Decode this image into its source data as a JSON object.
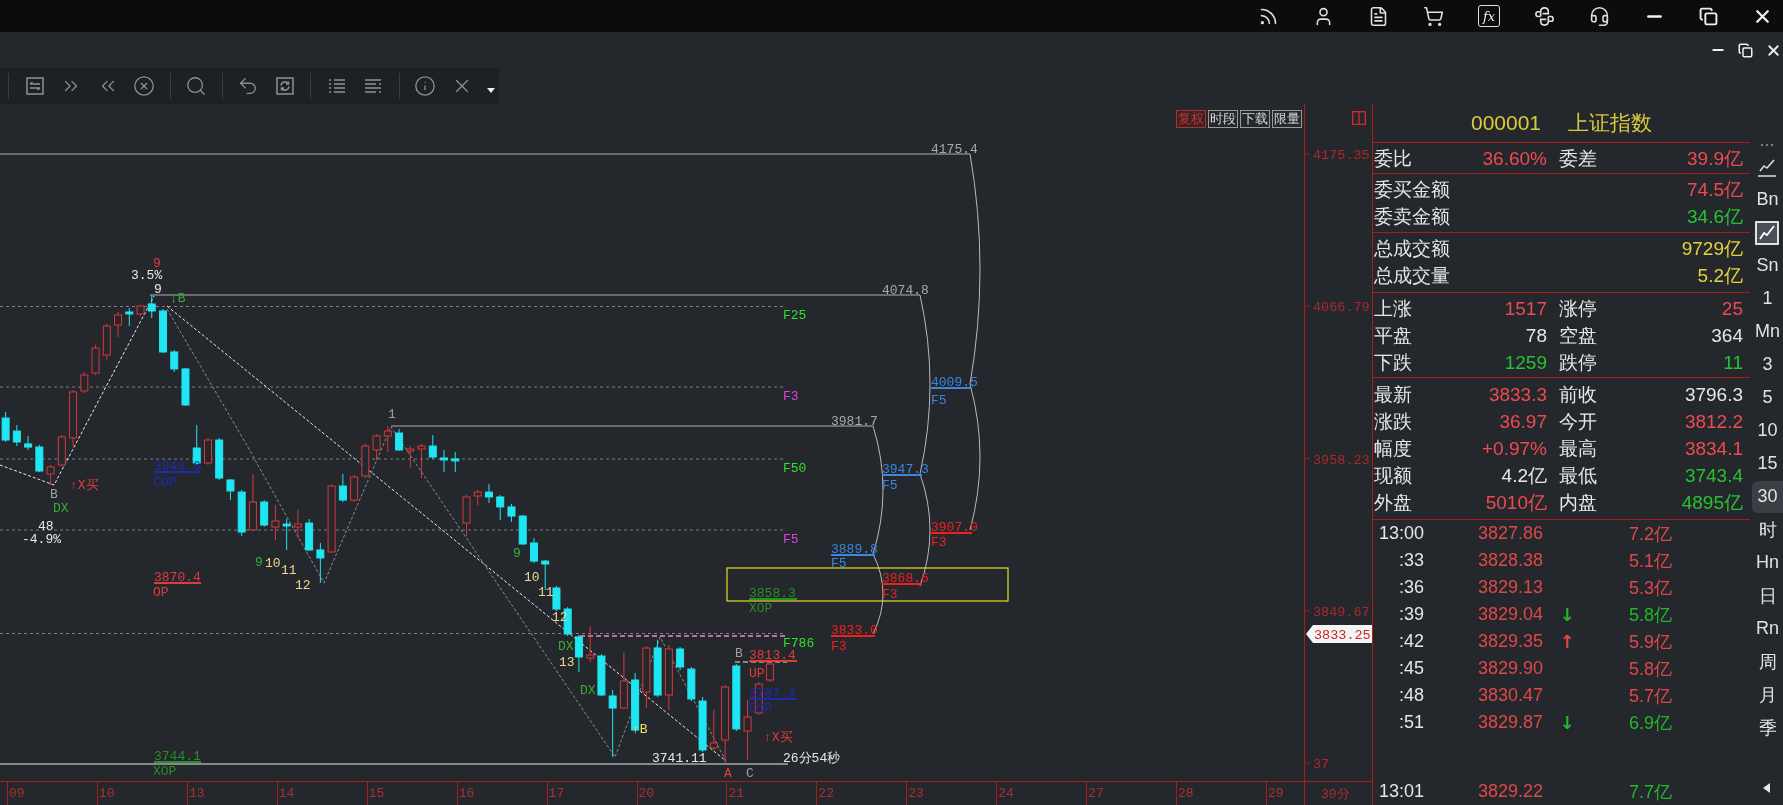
{
  "title_bar": {
    "formula_label": "fx"
  },
  "chart": {
    "buttons": [
      {
        "label": "复权",
        "on": true
      },
      {
        "label": "时段",
        "on": false
      },
      {
        "label": "下载",
        "on": false
      },
      {
        "label": "限量",
        "on": false
      }
    ],
    "chart_data": {
      "type": "candlestick",
      "categories": [
        null,
        "09",
        null,
        null,
        null,
        null,
        null,
        null,
        null,
        "10",
        null,
        null,
        null,
        null,
        null,
        null,
        null,
        "13",
        null,
        null,
        null,
        null,
        null,
        null,
        null,
        "14",
        null,
        null,
        null,
        null,
        null,
        null,
        null,
        "15",
        null,
        null,
        null,
        null,
        null,
        null,
        null,
        "16",
        null,
        null,
        null,
        null,
        null,
        null,
        null,
        "17",
        null,
        null,
        null,
        null,
        null,
        null,
        null,
        "20",
        null,
        null,
        null,
        null,
        null,
        null,
        null,
        "21",
        null,
        null,
        null,
        null,
        null,
        null,
        null,
        "22",
        null,
        null,
        null,
        null,
        null,
        null,
        null,
        "23",
        null,
        null,
        null,
        null,
        null,
        null,
        null,
        "24",
        null,
        null,
        null,
        null,
        null,
        null,
        null,
        "27",
        null,
        null,
        null,
        null,
        null,
        null,
        null,
        "28",
        null,
        null,
        null,
        null,
        null,
        null,
        null,
        "29",
        null,
        null
      ],
      "ohlc": [
        [
          3987.1,
          3991.4,
          3970.0,
          3971.4
        ],
        [
          3977.8,
          3982.1,
          3967.1,
          3970.0
        ],
        [
          3968.6,
          3974.3,
          3964.3,
          3966.4
        ],
        [
          3966.4,
          3967.9,
          3948.6,
          3949.3
        ],
        [
          3947.2,
          3953.6,
          3939.3,
          3952.2
        ],
        [
          3953.6,
          3975.0,
          3952.2,
          3973.6
        ],
        [
          3972.9,
          4007.1,
          3967.1,
          4005.7
        ],
        [
          4006.4,
          4019.9,
          4004.9,
          4017.8
        ],
        [
          4019.2,
          4039.2,
          4017.8,
          4037.0
        ],
        [
          4032.0,
          4054.1,
          4028.5,
          4052.7
        ],
        [
          4053.4,
          4062.7,
          4044.9,
          4060.6
        ],
        [
          4062.7,
          4065.5,
          4052.7,
          4061.3
        ],
        [
          4061.3,
          4067.7,
          4059.8,
          4067.0
        ],
        [
          4068.4,
          4074.8,
          4058.4,
          4063.4
        ],
        [
          4063.4,
          4064.8,
          4033.5,
          4034.2
        ],
        [
          4034.2,
          4035.6,
          4019.9,
          4022.1
        ],
        [
          4022.1,
          4022.8,
          3995.7,
          3996.4
        ],
        [
          3965.7,
          3982.1,
          3953.6,
          3955.0
        ],
        [
          3955.0,
          3972.9,
          3953.6,
          3971.4
        ],
        [
          3971.4,
          3972.9,
          3942.9,
          3944.3
        ],
        [
          3942.9,
          3943.6,
          3928.6,
          3935.1
        ],
        [
          3934.3,
          3935.8,
          3903.0,
          3905.8
        ],
        [
          3907.3,
          3947.2,
          3906.5,
          3927.2
        ],
        [
          3927.2,
          3928.6,
          3909.4,
          3910.8
        ],
        [
          3909.4,
          3925.1,
          3900.1,
          3913.7
        ],
        [
          3911.5,
          3915.1,
          3893.0,
          3910.1
        ],
        [
          3909.4,
          3921.5,
          3901.5,
          3911.5
        ],
        [
          3912.2,
          3915.1,
          3892.3,
          3893.0
        ],
        [
          3893.0,
          3898.0,
          3869.5,
          3887.3
        ],
        [
          3891.6,
          3940.1,
          3890.9,
          3938.6
        ],
        [
          3938.6,
          3947.2,
          3927.2,
          3928.6
        ],
        [
          3928.6,
          3946.5,
          3927.2,
          3945.0
        ],
        [
          3945.8,
          3968.6,
          3944.3,
          3967.1
        ],
        [
          3964.3,
          3975.7,
          3957.2,
          3974.3
        ],
        [
          3974.3,
          3981.4,
          3962.9,
          3977.8
        ],
        [
          3976.4,
          3979.3,
          3963.6,
          3964.3
        ],
        [
          3963.6,
          3967.1,
          3951.5,
          3965.0
        ],
        [
          3965.0,
          3968.6,
          3944.3,
          3967.1
        ],
        [
          3967.1,
          3975.0,
          3957.9,
          3959.3
        ],
        [
          3958.6,
          3964.3,
          3948.6,
          3957.2
        ],
        [
          3957.9,
          3962.9,
          3948.6,
          3956.5
        ],
        [
          3912.2,
          3932.2,
          3903.0,
          3930.8
        ],
        [
          3931.5,
          3935.8,
          3925.1,
          3934.3
        ],
        [
          3934.3,
          3940.1,
          3926.5,
          3930.8
        ],
        [
          3930.8,
          3932.2,
          3914.4,
          3923.7
        ],
        [
          3923.7,
          3925.8,
          3913.0,
          3917.2
        ],
        [
          3917.2,
          3917.9,
          3896.6,
          3897.3
        ],
        [
          3898.0,
          3901.5,
          3883.7,
          3885.1
        ],
        [
          3885.1,
          3885.9,
          3864.5,
          3883.0
        ],
        [
          3865.9,
          3867.3,
          3849.5,
          3850.9
        ],
        [
          3850.9,
          3852.3,
          3831.7,
          3833.1
        ],
        [
          3831.0,
          3832.4,
          3806.0,
          3816.7
        ],
        [
          3816.0,
          3838.8,
          3813.1,
          3818.1
        ],
        [
          3817.4,
          3818.8,
          3788.9,
          3789.6
        ],
        [
          3788.9,
          3793.2,
          3745.4,
          3780.3
        ],
        [
          3780.3,
          3820.3,
          3779.6,
          3799.6
        ],
        [
          3800.3,
          3805.3,
          3763.9,
          3764.6
        ],
        [
          3791.7,
          3824.5,
          3780.3,
          3823.1
        ],
        [
          3823.1,
          3828.8,
          3788.2,
          3789.6
        ],
        [
          3789.6,
          3825.3,
          3778.9,
          3822.4
        ],
        [
          3822.4,
          3823.8,
          3807.4,
          3809.6
        ],
        [
          3808.1,
          3809.6,
          3785.3,
          3786.8
        ],
        [
          3785.3,
          3788.2,
          3749.0,
          3750.4
        ],
        [
          3751.8,
          3778.9,
          3750.4,
          3755.4
        ],
        [
          3757.5,
          3796.7,
          3741.1,
          3795.3
        ],
        [
          3810.3,
          3811.7,
          3763.9,
          3765.4
        ],
        [
          3763.9,
          3786.0,
          3743.4,
          3773.9
        ],
        [
          3776.8,
          3798.9,
          3775.3,
          3797.4
        ],
        [
          3800.3,
          3813.1,
          3798.9,
          3811.7
        ],
        null,
        null,
        null,
        null,
        null,
        null,
        null,
        null,
        null,
        null,
        null,
        null,
        null,
        null,
        null,
        null,
        null,
        null,
        null,
        null,
        null,
        null,
        null,
        null,
        null,
        null,
        null,
        null,
        null,
        null,
        null,
        null,
        null,
        null,
        null,
        null,
        null,
        null,
        null,
        null,
        null,
        null,
        null,
        null,
        null,
        null,
        null
      ],
      "ylim": [
        3728.28,
        4192.46
      ],
      "yticks": [
        {
          "value": 4175.35,
          "label": "4175.35"
        },
        {
          "value": 4066.79,
          "label": "4066.79"
        },
        {
          "value": 3958.23,
          "label": "3958.23"
        },
        {
          "value": 3849.67,
          "label": "3849.67"
        }
      ]
    },
    "y_axis_bottom_label": "37",
    "annotations": [
      {
        "text": "4175.4",
        "color": "#a8a8a8",
        "kind": "label"
      },
      {
        "text": "9",
        "color": "#e03c3c",
        "kind": "label"
      },
      {
        "text": "3.5%",
        "color": "#e8e8e8",
        "kind": "label"
      },
      {
        "text": "9",
        "color": "#e8e8e8",
        "kind": "label"
      },
      {
        "text": "4074.8",
        "color": "#a8a8a8",
        "kind": "label"
      },
      {
        "text": "↓B",
        "color": "#34b034",
        "kind": "label"
      },
      {
        "text": "F25",
        "color": "#30e030",
        "kind": "label"
      },
      {
        "text": "4009.5",
        "color": "#3a86e0",
        "kind": "level"
      },
      {
        "text": "F3",
        "color": "#e040e0",
        "kind": "label"
      },
      {
        "text": "F5",
        "color": "#3a86e0",
        "kind": "label"
      },
      {
        "text": "1",
        "color": "#a0a0a0",
        "kind": "label"
      },
      {
        "text": "3981.7",
        "color": "#a8a8a8",
        "kind": "label"
      },
      {
        "text": "3948.6",
        "color": "#1c2bb0",
        "kind": "level"
      },
      {
        "text": "F50",
        "color": "#30e030",
        "kind": "label"
      },
      {
        "text": "3947.3",
        "color": "#3a86e0",
        "kind": "level"
      },
      {
        "text": "↑X买",
        "color": "#e03c3c",
        "kind": "label"
      },
      {
        "text": "COP",
        "color": "#1c2bb0",
        "kind": "label"
      },
      {
        "text": "F5",
        "color": "#3a86e0",
        "kind": "label"
      },
      {
        "text": "B",
        "color": "#a0a0a0",
        "kind": "label"
      },
      {
        "text": "DX",
        "color": "#34b034",
        "kind": "label"
      },
      {
        "text": "48",
        "color": "#e8e8e8",
        "kind": "label"
      },
      {
        "text": "3907.0",
        "color": "#ee2020",
        "kind": "level"
      },
      {
        "text": "-4.9%",
        "color": "#e8e8e8",
        "kind": "label"
      },
      {
        "text": "F5",
        "color": "#e040e0",
        "kind": "label"
      },
      {
        "text": "F3",
        "color": "#ee2020",
        "kind": "label"
      },
      {
        "text": "9",
        "color": "#34b034",
        "kind": "label"
      },
      {
        "text": "3889.8",
        "color": "#3a86e0",
        "kind": "level"
      },
      {
        "text": "9",
        "color": "#34b034",
        "kind": "label"
      },
      {
        "text": "10",
        "color": "#f0d890",
        "kind": "label"
      },
      {
        "text": "F5",
        "color": "#3a86e0",
        "kind": "label"
      },
      {
        "text": "11",
        "color": "#f0d890",
        "kind": "label"
      },
      {
        "text": "3870.4",
        "color": "#e03c3c",
        "kind": "level"
      },
      {
        "text": "10",
        "color": "#f0d890",
        "kind": "label"
      },
      {
        "text": "3868.6",
        "color": "#ee2020",
        "kind": "level"
      },
      {
        "text": "12",
        "color": "#f0d890",
        "kind": "label"
      },
      {
        "text": "OP",
        "color": "#e03c3c",
        "kind": "label"
      },
      {
        "text": "11",
        "color": "#f0d890",
        "kind": "label"
      },
      {
        "text": "3858.3",
        "color": "#2a8c2a",
        "kind": "level"
      },
      {
        "text": "F3",
        "color": "#ee2020",
        "kind": "label"
      },
      {
        "text": "XOP",
        "color": "#2a8c2a",
        "kind": "label"
      },
      {
        "text": "12",
        "color": "#f0d890",
        "kind": "label"
      },
      {
        "text": "3833.0",
        "color": "#ee2020",
        "kind": "level"
      },
      {
        "text": "DX",
        "color": "#34b034",
        "kind": "label"
      },
      {
        "text": "F786",
        "color": "#30e030",
        "kind": "label"
      },
      {
        "text": "F3",
        "color": "#ee2020",
        "kind": "label"
      },
      {
        "text": "B",
        "color": "#a0a0a0",
        "kind": "label"
      },
      {
        "text": "3813.4",
        "color": "#e03c3c",
        "kind": "level"
      },
      {
        "text": "13",
        "color": "#f0d890",
        "kind": "label"
      },
      {
        "text": "UP",
        "color": "#e03c3c",
        "kind": "label"
      },
      {
        "text": "DX",
        "color": "#34b034",
        "kind": "label"
      },
      {
        "text": "3787.3",
        "color": "#1c2bb0",
        "kind": "level"
      },
      {
        "text": "COP",
        "color": "#1c2bb0",
        "kind": "label"
      },
      {
        "text": "↑B",
        "color": "#f0e060",
        "kind": "label"
      },
      {
        "text": "↑X买",
        "color": "#e03c3c",
        "kind": "label"
      },
      {
        "text": "3744.1",
        "color": "#2a8c2a",
        "kind": "level"
      },
      {
        "text": "3741.11",
        "color": "#e8e8e8",
        "kind": "label"
      },
      {
        "text": "26分54秒",
        "color": "#e8e8e8",
        "kind": "label"
      },
      {
        "text": "XOP",
        "color": "#2a8c2a",
        "kind": "label"
      },
      {
        "text": "A",
        "color": "#e03c3c",
        "kind": "label"
      },
      {
        "text": "C",
        "color": "#a0a0a0",
        "kind": "label"
      }
    ],
    "current_price": "3833.25",
    "period": "30分"
  },
  "quote_panel": {
    "code": "000001",
    "name": "上证指数",
    "sections": [
      {
        "rows": [
          [
            {
              "label": "委比",
              "value": "36.60%",
              "color": "#ef4a4f"
            },
            {
              "label": "委差",
              "value": "39.9亿",
              "color": "#ef4a4f"
            }
          ]
        ]
      },
      {
        "rows": [
          [
            {
              "label": "委买金额",
              "value": "74.5亿",
              "color": "#ef4a4f"
            }
          ],
          [
            {
              "label": "委卖金额",
              "value": "34.6亿",
              "color": "#27c22f"
            }
          ]
        ]
      },
      {
        "rows": [
          [
            {
              "label": "总成交额",
              "value": "9729亿",
              "color": "#e3d43a"
            }
          ],
          [
            {
              "label": "总成交量",
              "value": "5.2亿",
              "color": "#e3d43a"
            }
          ]
        ]
      },
      {
        "rows": [
          [
            {
              "label": "上涨",
              "value": "1517",
              "color": "#ef4a4f"
            },
            {
              "label": "涨停",
              "value": "25",
              "color": "#ef4a4f"
            }
          ],
          [
            {
              "label": "平盘",
              "value": "78",
              "color": "#e6e6e6"
            },
            {
              "label": "空盘",
              "value": "364",
              "color": "#e6e6e6"
            }
          ],
          [
            {
              "label": "下跌",
              "value": "1259",
              "color": "#27c22f"
            },
            {
              "label": "跌停",
              "value": "11",
              "color": "#27c22f"
            }
          ]
        ]
      },
      {
        "rows": [
          [
            {
              "label": "最新",
              "value": "3833.3",
              "color": "#ef4a4f"
            },
            {
              "label": "前收",
              "value": "3796.3",
              "color": "#e6e6e6"
            }
          ],
          [
            {
              "label": "涨跌",
              "value": "36.97",
              "color": "#ef4a4f"
            },
            {
              "label": "今开",
              "value": "3812.2",
              "color": "#ef4a4f"
            }
          ],
          [
            {
              "label": "幅度",
              "value": "+0.97%",
              "color": "#ef4a4f"
            },
            {
              "label": "最高",
              "value": "3834.1",
              "color": "#ef4a4f"
            }
          ],
          [
            {
              "label": "现额",
              "value": "4.2亿",
              "color": "#e6e6e6"
            },
            {
              "label": "最低",
              "value": "3743.4",
              "color": "#27c22f"
            }
          ],
          [
            {
              "label": "外盘",
              "value": "5010亿",
              "color": "#ef4a4f"
            },
            {
              "label": "内盘",
              "value": "4895亿",
              "color": "#27c22f"
            }
          ]
        ]
      }
    ],
    "ticks": [
      {
        "time": "13:00",
        "price": "3827.86",
        "volume": "7.2亿",
        "color": "#e04848"
      },
      {
        "time": ":33",
        "price": "3828.38",
        "volume": "5.1亿",
        "color": "#e04848"
      },
      {
        "time": ":36",
        "price": "3829.13",
        "volume": "5.3亿",
        "color": "#e04848"
      },
      {
        "time": ":39",
        "price": "3829.04",
        "arrow": "↓",
        "volume": "5.8亿",
        "color": "#22b82a"
      },
      {
        "time": ":42",
        "price": "3829.35",
        "arrow": "↑",
        "volume": "5.9亿",
        "color": "#e04848"
      },
      {
        "time": ":45",
        "price": "3829.90",
        "volume": "5.8亿",
        "color": "#e04848"
      },
      {
        "time": ":48",
        "price": "3830.47",
        "volume": "5.7亿",
        "color": "#e04848"
      },
      {
        "time": ":51",
        "price": "3829.87",
        "arrow": "↓",
        "volume": "6.9亿",
        "color": "#22b82a"
      },
      {
        "time": "13:01",
        "price": "3829.22",
        "volume": "7.7亿",
        "color": "#22b82a"
      }
    ]
  },
  "sidebar": {
    "items": [
      {
        "kind": "icon",
        "selected": false
      },
      {
        "kind": "text",
        "label": "Bn",
        "selected": false
      },
      {
        "kind": "icon",
        "selected": true
      },
      {
        "kind": "text",
        "label": "Sn",
        "selected": false
      },
      {
        "kind": "text",
        "label": "1",
        "selected": false
      },
      {
        "kind": "text",
        "label": "Mn",
        "selected": false
      },
      {
        "kind": "text",
        "label": "3",
        "selected": false
      },
      {
        "kind": "text",
        "label": "5",
        "selected": false
      },
      {
        "kind": "text",
        "label": "10",
        "selected": false
      },
      {
        "kind": "text",
        "label": "15",
        "selected": false
      },
      {
        "kind": "text",
        "label": "30",
        "selected": true
      },
      {
        "kind": "text",
        "label": "时",
        "selected": false
      },
      {
        "kind": "text",
        "label": "Hn",
        "selected": false
      },
      {
        "kind": "text",
        "label": "日",
        "selected": false
      },
      {
        "kind": "text",
        "label": "Rn",
        "selected": false
      },
      {
        "kind": "text",
        "label": "周",
        "selected": false
      },
      {
        "kind": "text",
        "label": "月",
        "selected": false
      },
      {
        "kind": "text",
        "label": "季",
        "selected": false
      }
    ]
  }
}
